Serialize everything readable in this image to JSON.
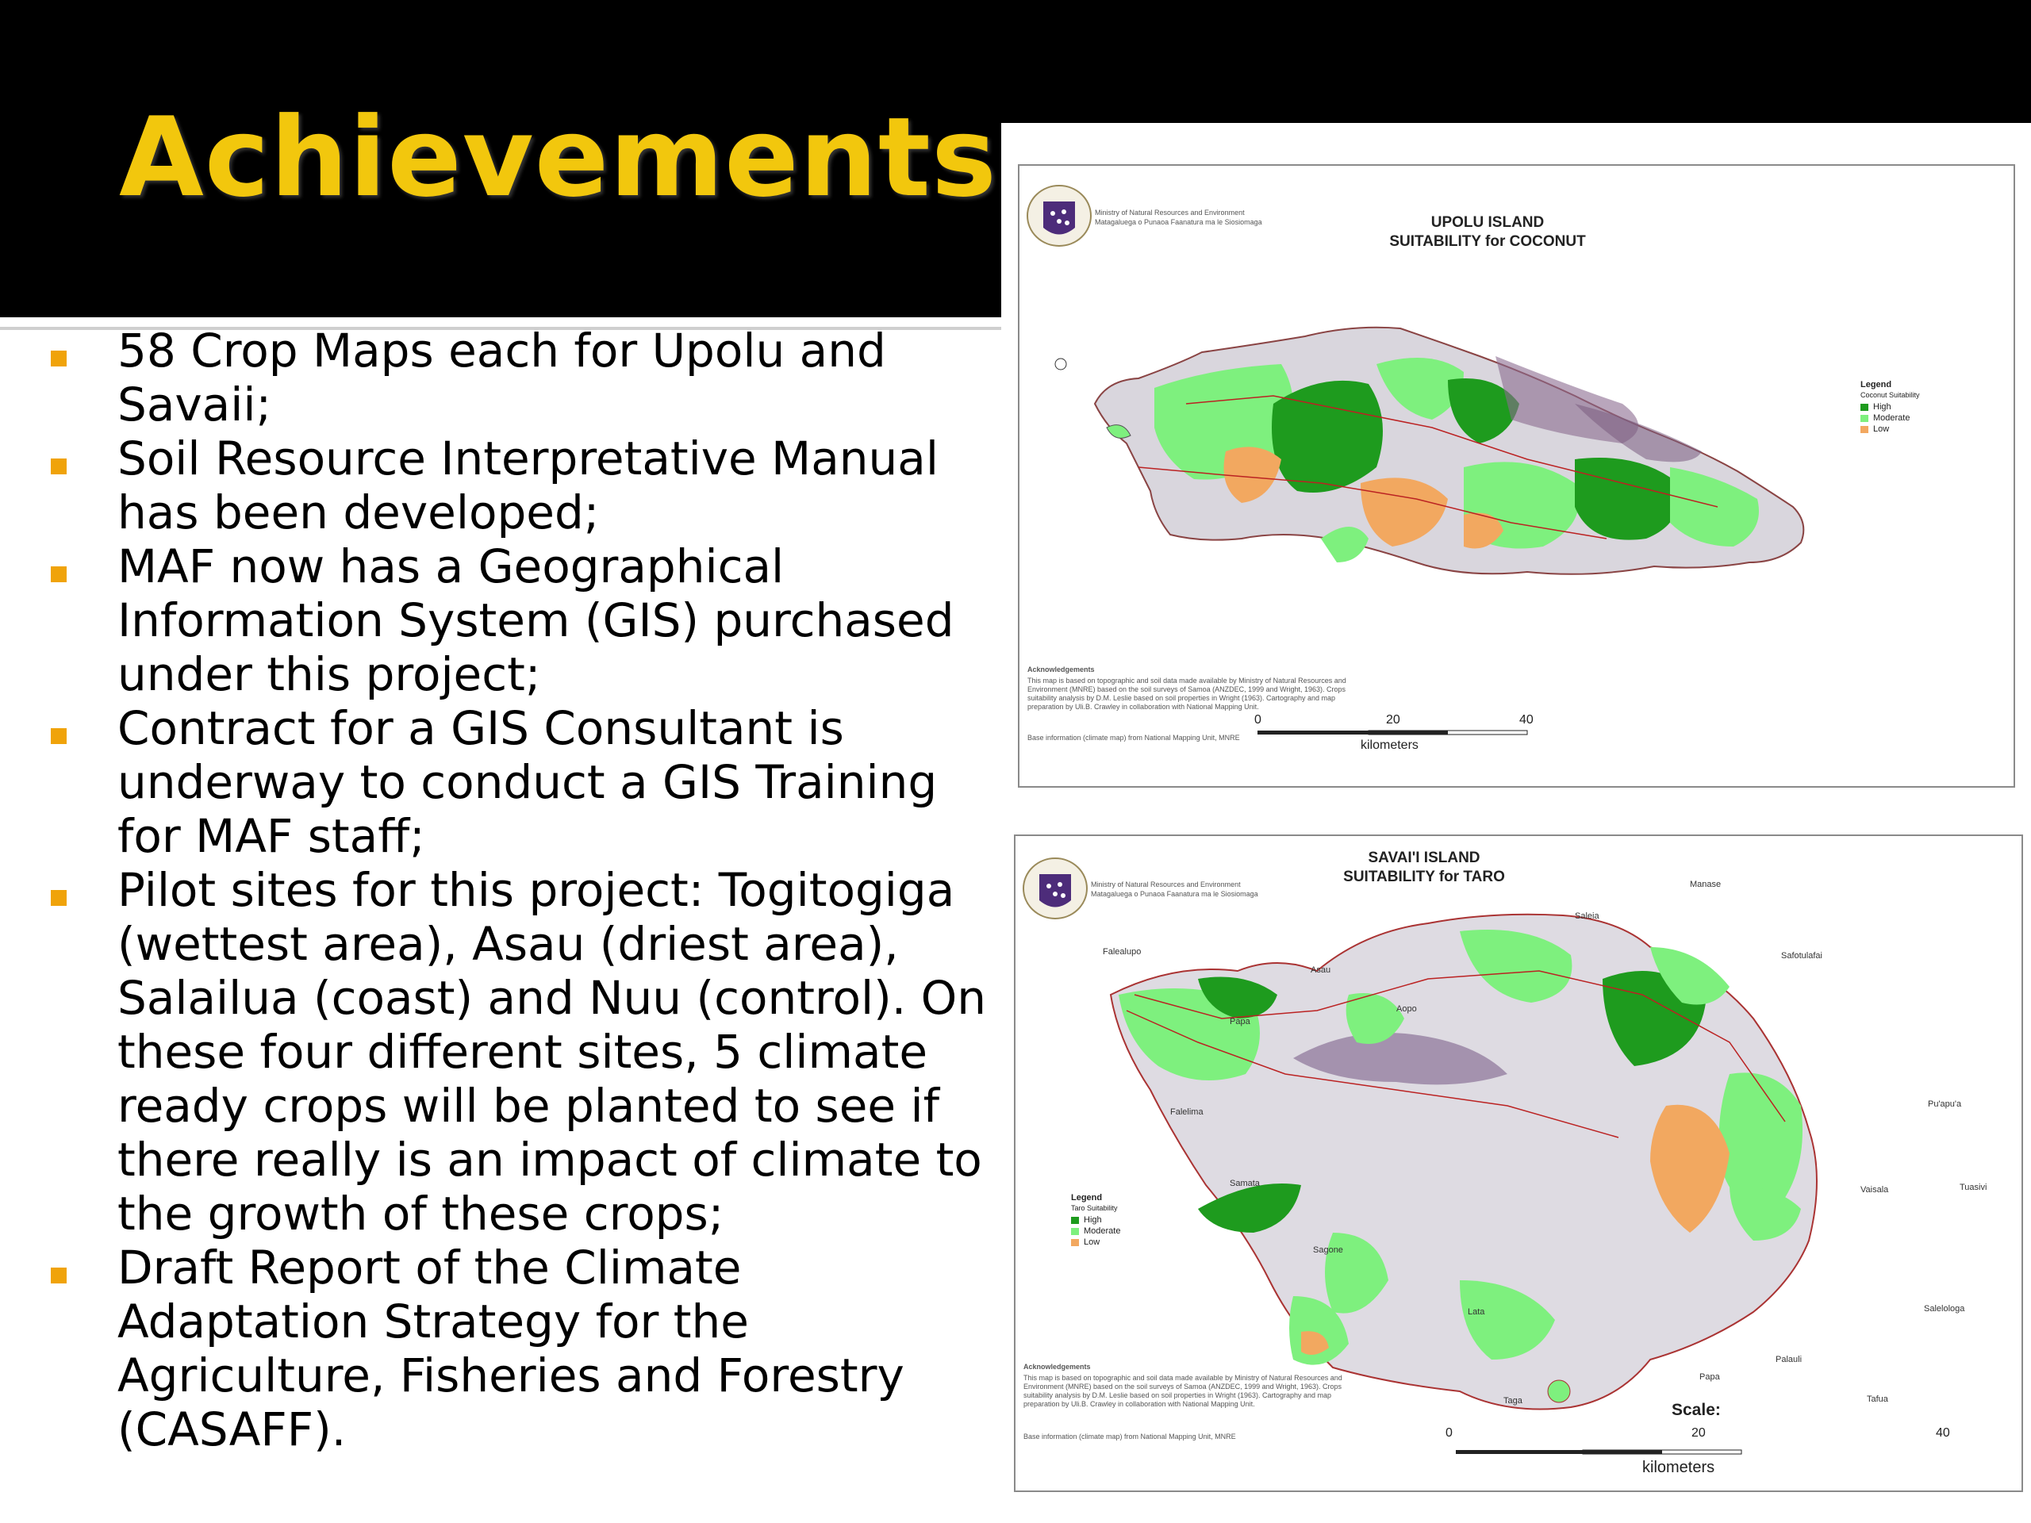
{
  "slide": {
    "title": "Achievements",
    "bullets": [
      "58 Crop Maps each for Upolu and Savaii;",
      "Soil Resource Interpretative Manual has been developed;",
      "MAF now has a Geographical Information System (GIS) purchased under this project;",
      "Contract for a GIS Consultant is underway to conduct a GIS Training for MAF staff;",
      "Pilot sites for this project: Togitogiga (wettest area), Asau (driest area), Salailua (coast) and Nuu (control). On these four different sites, 5 climate ready crops will be planted to see if there really is an impact of climate to the growth of these crops;",
      "Draft Report of the Climate Adaptation Strategy for the Agriculture, Fisheries and Forestry (CASAFF)."
    ]
  },
  "colors": {
    "title": "#f2c70d",
    "bullet_marker": "#f0a30a",
    "high": "#1e9b1e",
    "moderate": "#7ef07e",
    "low": "#f2a860"
  },
  "maps": {
    "upolu": {
      "ministry": "Ministry of Natural Resources and Environment",
      "ministry_sub": "Matagaluega o Punaoa Faanatura ma le Siosiomaga",
      "title_line1": "UPOLU ISLAND",
      "title_line2": "SUITABILITY for COCONUT",
      "legend_title": "Legend",
      "legend_sub": "Coconut Suitability",
      "legend_items": [
        "High",
        "Moderate",
        "Low"
      ],
      "ack_title": "Acknowledgements",
      "ack_text": "This map is based on topographic and soil data made available by Ministry of Natural Resources and Environment (MNRE) based on the soil surveys of Samoa (ANZDEC, 1999 and Wright, 1963). Crops suitability analysis by D.M. Leslie based on soil properties in Wright (1963). Cartography and map preparation by Uli.B. Crawley in collaboration with National Mapping Unit.",
      "base_info": "Base information (climate map) from National Mapping Unit, MNRE",
      "scale_ticks": [
        "0",
        "20",
        "40"
      ],
      "scale_unit": "kilometers"
    },
    "savaii": {
      "ministry": "Ministry of Natural Resources and Environment",
      "ministry_sub": "Matagaluega o Punaoa Faanatura ma le Siosiomaga",
      "title_line1": "SAVAI'I ISLAND",
      "title_line2": "SUITABILITY for TARO",
      "legend_title": "Legend",
      "legend_sub": "Taro Suitability",
      "legend_items": [
        "High",
        "Moderate",
        "Low"
      ],
      "ack_title": "Acknowledgements",
      "ack_text": "This map is based on topographic and soil data made available by Ministry of Natural Resources and Environment (MNRE) based on the soil surveys of Samoa (ANZDEC, 1999 and Wright, 1963). Crops suitability analysis by D.M. Leslie based on soil properties in Wright (1963). Cartography and map preparation by Uli.B. Crawley in collaboration with National Mapping Unit.",
      "base_info": "Base information (climate map) from National Mapping Unit, MNRE",
      "scale_label": "Scale:",
      "scale_ticks": [
        "0",
        "20",
        "40"
      ],
      "scale_unit": "kilometers",
      "place_labels": [
        "Manase",
        "Saleia",
        "Safotulafai",
        "Falealupo",
        "Asau",
        "Papa",
        "Aopo",
        "Falelima",
        "Pu'apu'a",
        "Samata",
        "Tuasivi",
        "Sagone",
        "Vaisala",
        "Salelologa",
        "Lata",
        "Palauli",
        "Papa",
        "Taga",
        "Tafua"
      ]
    }
  }
}
